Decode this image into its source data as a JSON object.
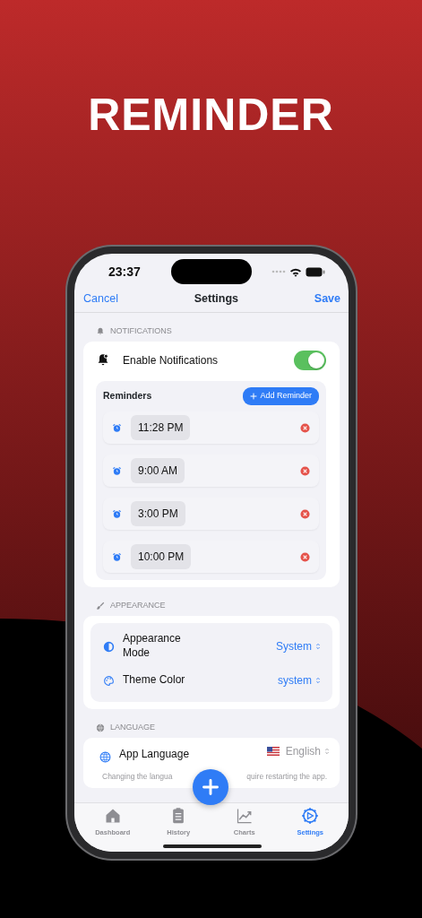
{
  "title": "REMINDER",
  "status_bar": {
    "time": "23:37"
  },
  "nav": {
    "cancel": "Cancel",
    "title": "Settings",
    "save": "Save"
  },
  "notifications": {
    "header": "NOTIFICATIONS",
    "toggle": {
      "label": "Enable Notifications",
      "on": true
    },
    "reminders": {
      "title": "Reminders",
      "add_button": "Add Reminder",
      "items": [
        {
          "time": "11:28 PM"
        },
        {
          "time": "9:00 AM"
        },
        {
          "time": "3:00 PM"
        },
        {
          "time": "10:00 PM"
        }
      ]
    }
  },
  "appearance": {
    "header": "APPEARANCE",
    "rows": [
      {
        "kind": "mode",
        "label": "Appearance Mode",
        "value": "System"
      },
      {
        "kind": "palette",
        "label": "Theme Color",
        "value": "system"
      }
    ]
  },
  "language": {
    "header": "LANGUAGE",
    "label": "App Language",
    "value": "English",
    "note_parts": [
      "Changing the langua",
      "quire restarting the app."
    ]
  },
  "tabs": [
    {
      "kind": "home",
      "label": "Dashboard",
      "selected": false
    },
    {
      "kind": "clipboard",
      "label": "History",
      "selected": false
    },
    {
      "kind": "chart",
      "label": "Charts",
      "selected": false
    },
    {
      "kind": "gear",
      "label": "Settings",
      "selected": true
    }
  ]
}
